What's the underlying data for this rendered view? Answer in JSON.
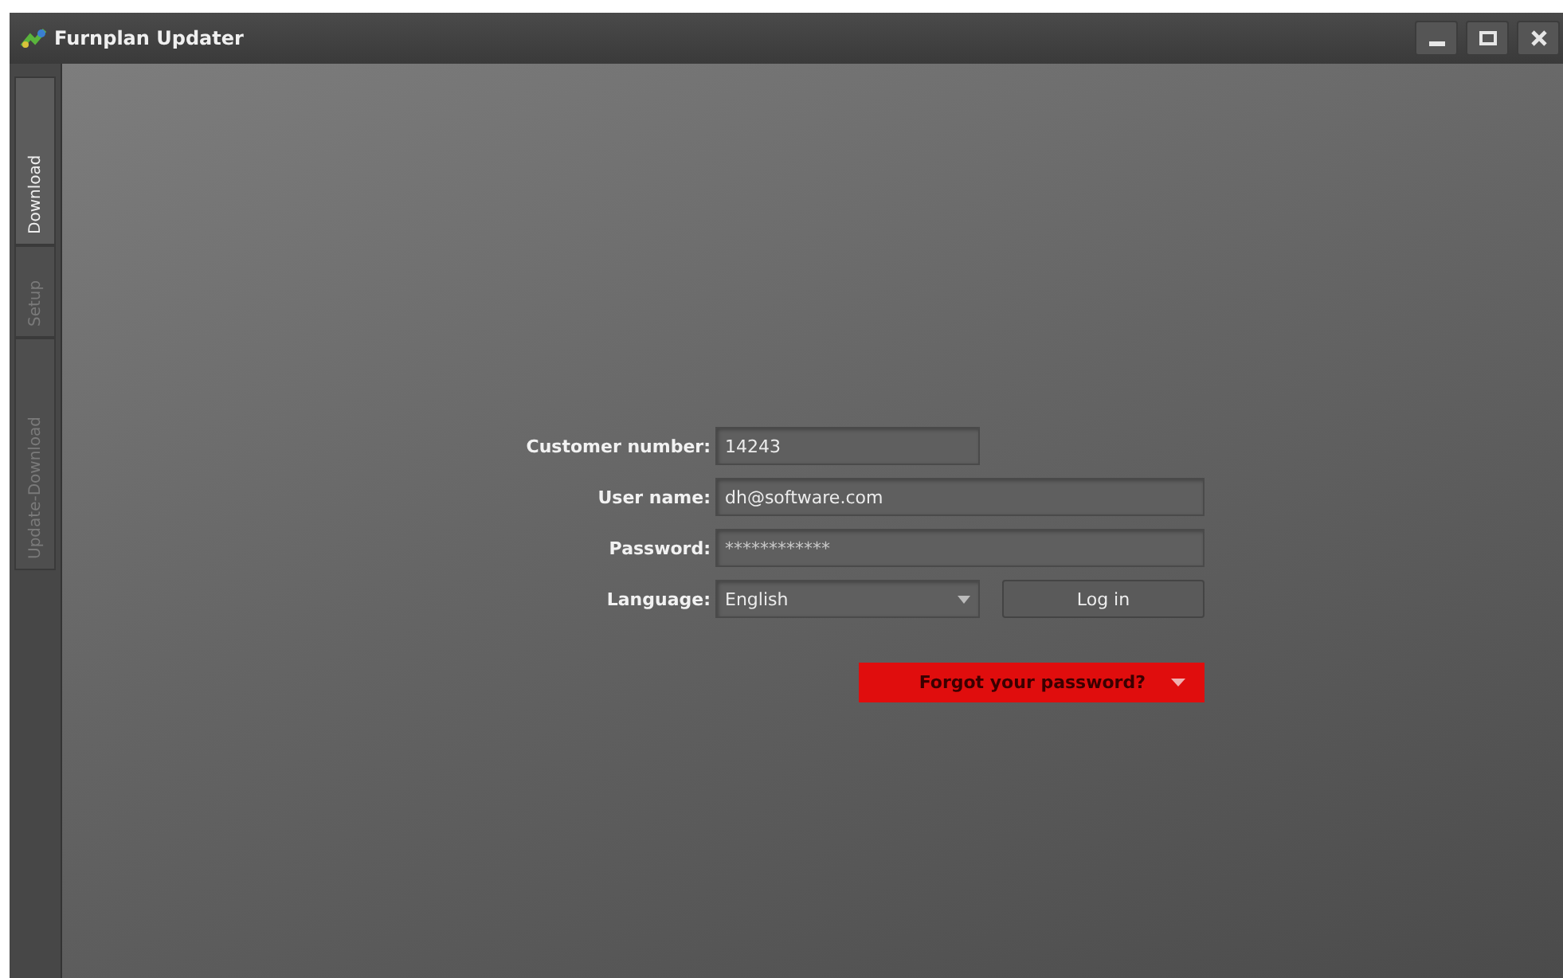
{
  "window": {
    "title": "Furnplan Updater"
  },
  "tabs": [
    {
      "label": "Download",
      "selected": true
    },
    {
      "label": "Setup",
      "selected": false
    },
    {
      "label": "Update-Download",
      "selected": false
    }
  ],
  "form": {
    "fields": [
      {
        "kind": "text",
        "label": "Customer number:",
        "value": "14243"
      },
      {
        "kind": "text",
        "label": "User name:",
        "value": "dh@software.com"
      },
      {
        "kind": "password",
        "label": "Password:",
        "value": "************"
      },
      {
        "kind": "select",
        "label": "Language:",
        "value": "English"
      }
    ],
    "login_button": "Log in",
    "forgot_button": "Forgot your password?"
  }
}
